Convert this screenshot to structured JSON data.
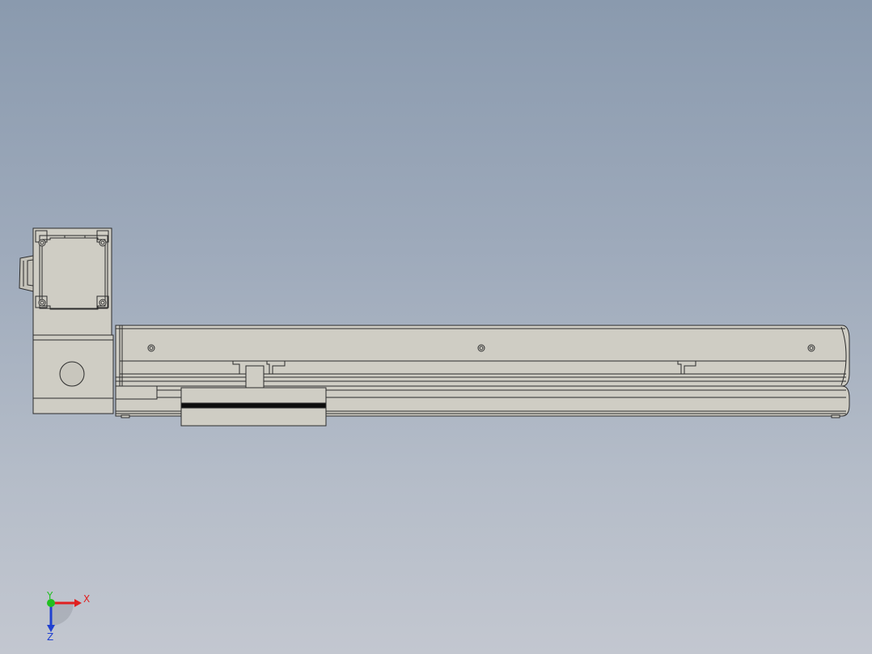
{
  "viewport": {
    "background_top": "#8a9aae",
    "background_bottom": "#c3c7d0"
  },
  "model": {
    "part_fill": "#cfcdc4",
    "part_fill_dark": "#b9b7ae",
    "edge_color": "#2b2b2b",
    "strip_color": "#0d0d0d"
  },
  "triad": {
    "x_label": "X",
    "y_label": "Y",
    "z_label": "Z",
    "x_color": "#e02020",
    "y_color": "#20c020",
    "z_color": "#2040d0"
  }
}
